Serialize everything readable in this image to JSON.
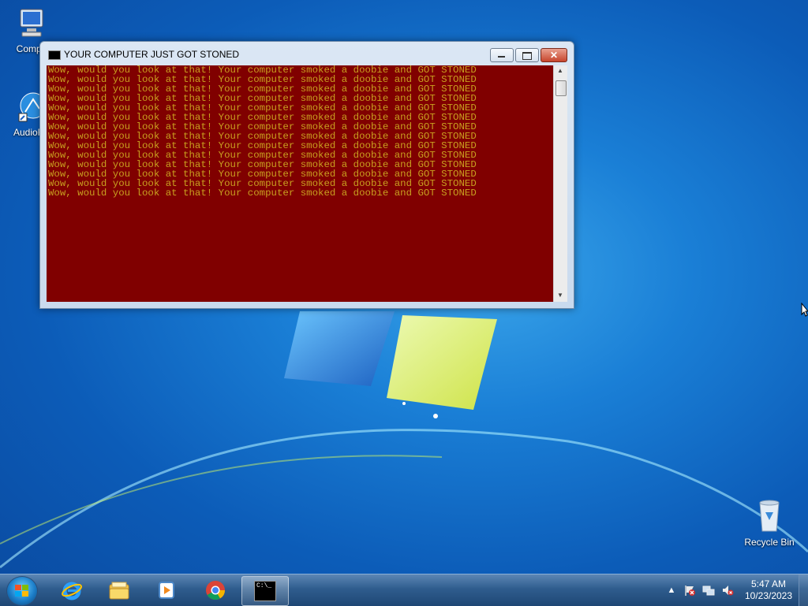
{
  "desktop": {
    "icons": [
      {
        "name": "computer-icon",
        "label": "Compu"
      },
      {
        "name": "audio-recorder-icon",
        "label": "AudioRe"
      },
      {
        "name": "recycle-bin-icon",
        "label": "Recycle Bin"
      }
    ]
  },
  "window": {
    "title": "YOUR COMPUTER JUST GOT STONED",
    "close_glyph": "✕",
    "console_lines": [
      "Wow, would you look at that! Your computer smoked a doobie and GOT STONED",
      "Wow, would you look at that! Your computer smoked a doobie and GOT STONED",
      "Wow, would you look at that! Your computer smoked a doobie and GOT STONED",
      "Wow, would you look at that! Your computer smoked a doobie and GOT STONED",
      "Wow, would you look at that! Your computer smoked a doobie and GOT STONED",
      "Wow, would you look at that! Your computer smoked a doobie and GOT STONED",
      "Wow, would you look at that! Your computer smoked a doobie and GOT STONED",
      "Wow, would you look at that! Your computer smoked a doobie and GOT STONED",
      "Wow, would you look at that! Your computer smoked a doobie and GOT STONED",
      "Wow, would you look at that! Your computer smoked a doobie and GOT STONED",
      "Wow, would you look at that! Your computer smoked a doobie and GOT STONED",
      "Wow, would you look at that! Your computer smoked a doobie and GOT STONED",
      "Wow, would you look at that! Your computer smoked a doobie and GOT STONED",
      "Wow, would you look at that! Your computer smoked a doobie and GOT STONED"
    ],
    "console_bg": "#800000",
    "console_fg": "#c8a020"
  },
  "taskbar": {
    "apps": [
      "internet-explorer-icon",
      "file-explorer-icon",
      "media-player-icon",
      "chrome-icon",
      "command-prompt-icon"
    ],
    "cmd_glyph": "C:\\_",
    "tray_glyphs": {
      "up": "▲"
    },
    "clock": {
      "time": "5:47 AM",
      "date": "10/23/2023"
    }
  }
}
